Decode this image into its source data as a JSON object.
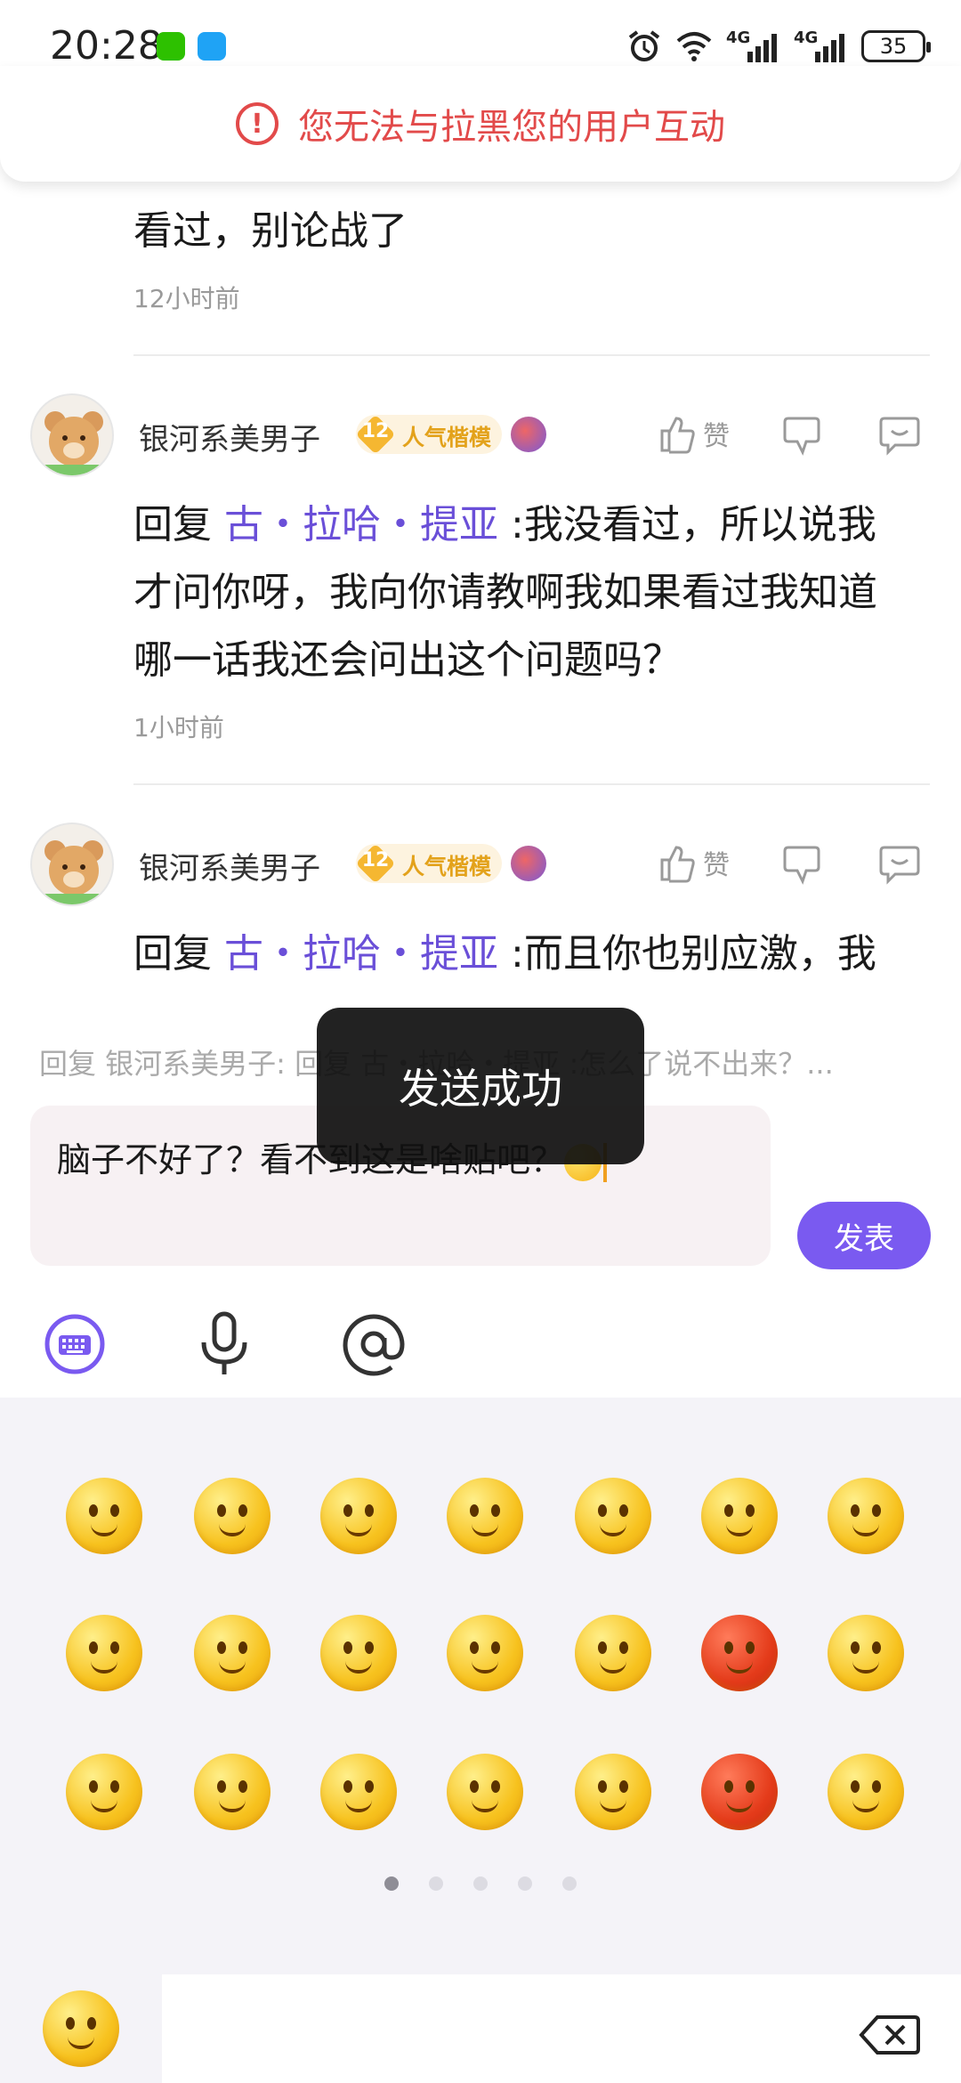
{
  "status_bar": {
    "time": "20:28",
    "net1": "4G",
    "net2": "4G",
    "battery": "35"
  },
  "banner": {
    "text": "您无法与拉黑您的用户互动"
  },
  "comments": [
    {
      "text": "看过，别论战了",
      "time": "12小时前"
    },
    {
      "username": "银河系美男子",
      "level": "12",
      "badge": "人气楷模",
      "like_label": "赞",
      "reply_prefix": "回复",
      "reply_to": "古・拉哈・提亚",
      "line1": ":我没看过，所以说我",
      "line2": "才问你呀，我向你请教啊我如果看过我知道",
      "line3": "哪一话我还会问出这个问题吗？",
      "time": "1小时前"
    },
    {
      "username": "银河系美男子",
      "level": "12",
      "badge": "人气楷模",
      "like_label": "赞",
      "reply_prefix": "回复",
      "reply_to": "古・拉哈・提亚",
      "line1": ":而且你也别应激，我"
    }
  ],
  "reply_box": {
    "hint": "回复 银河系美男子: 回复 古・拉哈・提亚 :怎么了说不出来？...",
    "input_value": "脑子不好了？看不到这是啥贴吧？",
    "publish_label": "发表"
  },
  "toast": {
    "text": "发送成功"
  },
  "emoji_panel": {
    "pages": 5,
    "active_page": 1
  },
  "colors": {
    "accent": "#7a5af0",
    "warning": "#e24a4a",
    "link": "#6a4fd8",
    "badge": "#e3a21b"
  },
  "icons": {
    "toolbar": [
      "keyboard-icon",
      "microphone-icon",
      "at-icon"
    ],
    "bottom": [
      "emoji-icon",
      "backspace-icon"
    ]
  }
}
